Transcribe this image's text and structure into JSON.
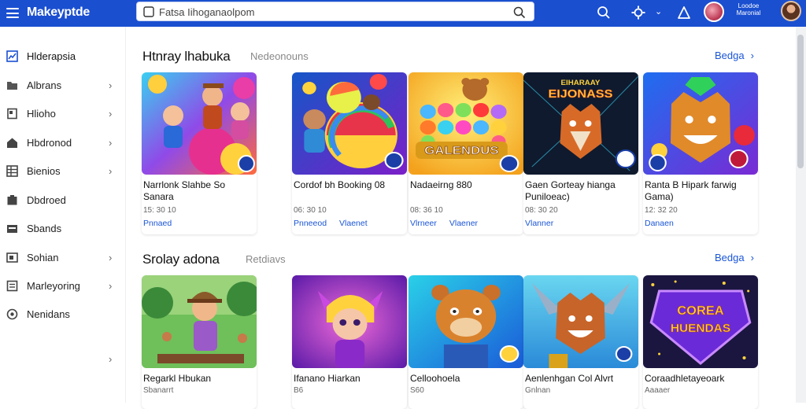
{
  "topbar": {
    "brand": "Makeyptde",
    "search_value": "Fatsa Iihoganaolpom",
    "user_line1": "Loodoe",
    "user_line2": "Maronial",
    "icons": [
      "menu-icon",
      "search-icon",
      "settings-icon",
      "chevron-down-icon",
      "alert-icon",
      "badge-avatar",
      "user-avatar"
    ]
  },
  "sidebar": {
    "items": [
      {
        "label": "Hlderapsia",
        "icon": "chart-icon",
        "chevron": false
      },
      {
        "label": "Albrans",
        "icon": "folder-icon",
        "chevron": true
      },
      {
        "label": "Hlioho",
        "icon": "document-icon",
        "chevron": true
      },
      {
        "label": "Hbdronod",
        "icon": "home-icon",
        "chevron": true
      },
      {
        "label": "Bienios",
        "icon": "grid-icon",
        "chevron": true
      },
      {
        "label": "Dbdroed",
        "icon": "package-icon",
        "chevron": false
      },
      {
        "label": "Sbands",
        "icon": "card-icon",
        "chevron": false
      },
      {
        "label": "Sohian",
        "icon": "archive-icon",
        "chevron": true
      },
      {
        "label": "Marleyoring",
        "icon": "list-icon",
        "chevron": true
      },
      {
        "label": "Nenidans",
        "icon": "gear-icon",
        "chevron": false
      }
    ],
    "bottom_chevron": "›"
  },
  "sections": [
    {
      "title": "Htnray lhabuka",
      "subtitle": "Nedeonouns",
      "link": "Bedga",
      "cards": [
        {
          "title": "Narrlonk Slahbe So Sanara",
          "meta": "15: 30 10",
          "links": [
            "Pnnaed"
          ]
        },
        {
          "title": "Cordof bh Booking 08",
          "meta": "06: 30 10",
          "links": [
            "Pnneeod",
            "Vlaenet"
          ]
        },
        {
          "title": "Nadaeirng 880",
          "meta": "08: 36 10",
          "links": [
            "Vlrneer",
            "Vlaener"
          ]
        },
        {
          "title": "Gaen Gorteay hianga Puniloeac)",
          "meta": "08: 30 20",
          "links": [
            "Vlanner"
          ]
        },
        {
          "title": "Ranta B Hipark farwig Gama)",
          "meta": "12: 32 20",
          "links": [
            "Danaen"
          ]
        }
      ],
      "art": [
        "blob-party",
        "ball-roll",
        "candy-bear",
        "neon-fox",
        "jewel-tiger"
      ],
      "art_text": [
        "",
        "",
        "GALENDUS",
        "EIJONASS",
        ""
      ]
    },
    {
      "title": "Srolay adona",
      "subtitle": "Retdiavs",
      "link": "Bedga",
      "cards": [
        {
          "title": "Regarkl Hbukan",
          "meta": "Sbanarrt"
        },
        {
          "title": "Ifanano Hiarkan",
          "meta": "B6"
        },
        {
          "title": "Celloohoela",
          "meta": "S60"
        },
        {
          "title": "Aenlenhgan Col Alvrt",
          "meta": "Gnlnan"
        },
        {
          "title": "Coraadhletayeoark",
          "meta": "Aaaaer"
        }
      ],
      "art": [
        "forest-boy",
        "fairy-girl",
        "bear-hero",
        "wolf-hero",
        "gem-logo"
      ],
      "art_text": [
        "",
        "",
        "",
        "",
        "COREA HUENDAS"
      ]
    }
  ]
}
